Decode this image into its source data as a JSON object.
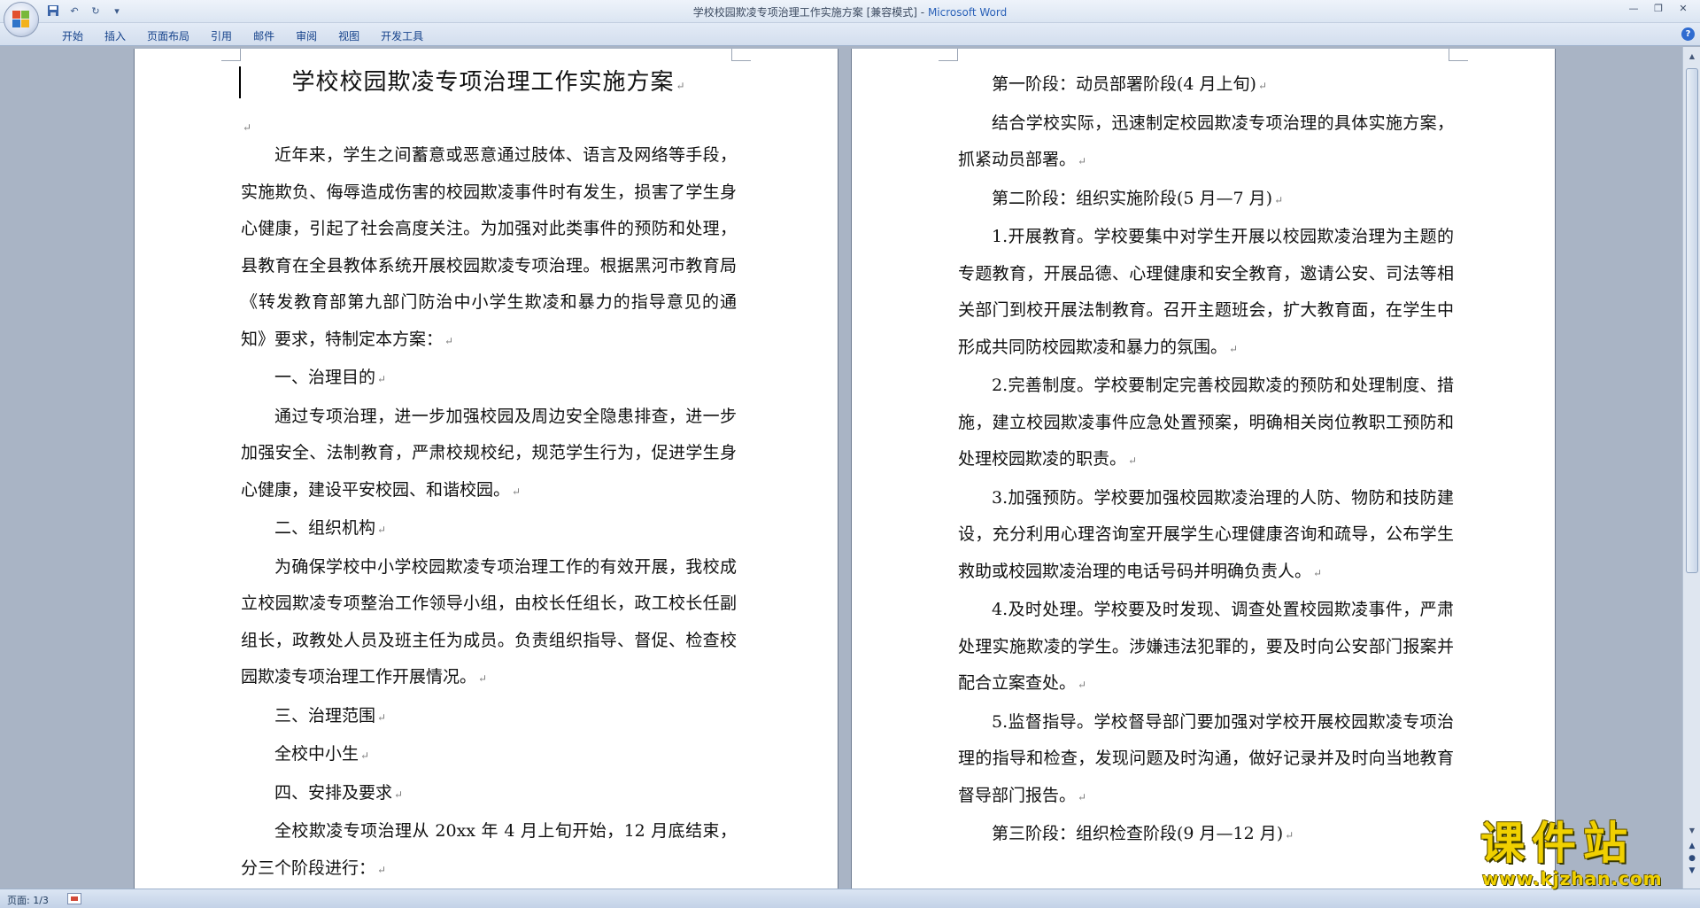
{
  "window": {
    "title": "学校校园欺凌专项治理工作实施方案 [兼容模式]",
    "title_sep": " - ",
    "app_name": "Microsoft Word"
  },
  "ribbon": {
    "tabs": [
      "开始",
      "插入",
      "页面布局",
      "引用",
      "邮件",
      "审阅",
      "视图",
      "开发工具"
    ]
  },
  "document": {
    "title": "学校校园欺凌专项治理工作实施方案",
    "left_paragraphs": [
      "近年来，学生之间蓄意或恶意通过肢体、语言及网络等手段，实施欺负、侮辱造成伤害的校园欺凌事件时有发生，损害了学生身心健康，引起了社会高度关注。为加强对此类事件的预防和处理，县教育在全县教体系统开展校园欺凌专项治理。根据黑河市教育局《转发教育部第九部门防治中小学生欺凌和暴力的指导意见的通知》要求，特制定本方案：",
      "一、治理目的",
      "通过专项治理，进一步加强校园及周边安全隐患排查，进一步加强安全、法制教育，严肃校规校纪，规范学生行为，促进学生身心健康，建设平安校园、和谐校园。",
      "二、组织机构",
      "为确保学校中小学校园欺凌专项治理工作的有效开展，我校成立校园欺凌专项整治工作领导小组，由校长任组长，政工校长任副组长，政教处人员及班主任为成员。负责组织指导、督促、检查校园欺凌专项治理工作开展情况。",
      "三、治理范围",
      "全校中小生",
      "四、安排及要求",
      "全校欺凌专项治理从 20xx 年 4 月上旬开始，12 月底结束，分三个阶段进行："
    ],
    "right_paragraphs": [
      "第一阶段：动员部署阶段(4 月上旬)",
      "结合学校实际，迅速制定校园欺凌专项治理的具体实施方案，抓紧动员部署。",
      "第二阶段：组织实施阶段(5 月—7 月)",
      "1.开展教育。学校要集中对学生开展以校园欺凌治理为主题的专题教育，开展品德、心理健康和安全教育，邀请公安、司法等相关部门到校开展法制教育。召开主题班会，扩大教育面，在学生中形成共同防校园欺凌和暴力的氛围。",
      "2.完善制度。学校要制定完善校园欺凌的预防和处理制度、措施，建立校园欺凌事件应急处置预案，明确相关岗位教职工预防和处理校园欺凌的职责。",
      "3.加强预防。学校要加强校园欺凌治理的人防、物防和技防建设，充分利用心理咨询室开展学生心理健康咨询和疏导，公布学生救助或校园欺凌治理的电话号码并明确负责人。",
      "4.及时处理。学校要及时发现、调查处置校园欺凌事件，严肃处理实施欺凌的学生。涉嫌违法犯罪的，要及时向公安部门报案并配合立案查处。",
      "5.监督指导。学校督导部门要加强对学校开展校园欺凌专项治理的指导和检查，发现问题及时沟通，做好记录并及时向当地教育督导部门报告。",
      "第三阶段：组织检查阶段(9 月—12 月)"
    ],
    "paragraph_mark": "↵"
  },
  "status": {
    "page_indicator": "页面: 1/3"
  },
  "watermark": {
    "cn": "课件站",
    "url": "www.kjzhan.com"
  },
  "colors": {
    "accent": "#15428b",
    "app_name": "#2a61b8",
    "workspace": "#a9b4c5",
    "watermark": "#f0d000"
  }
}
